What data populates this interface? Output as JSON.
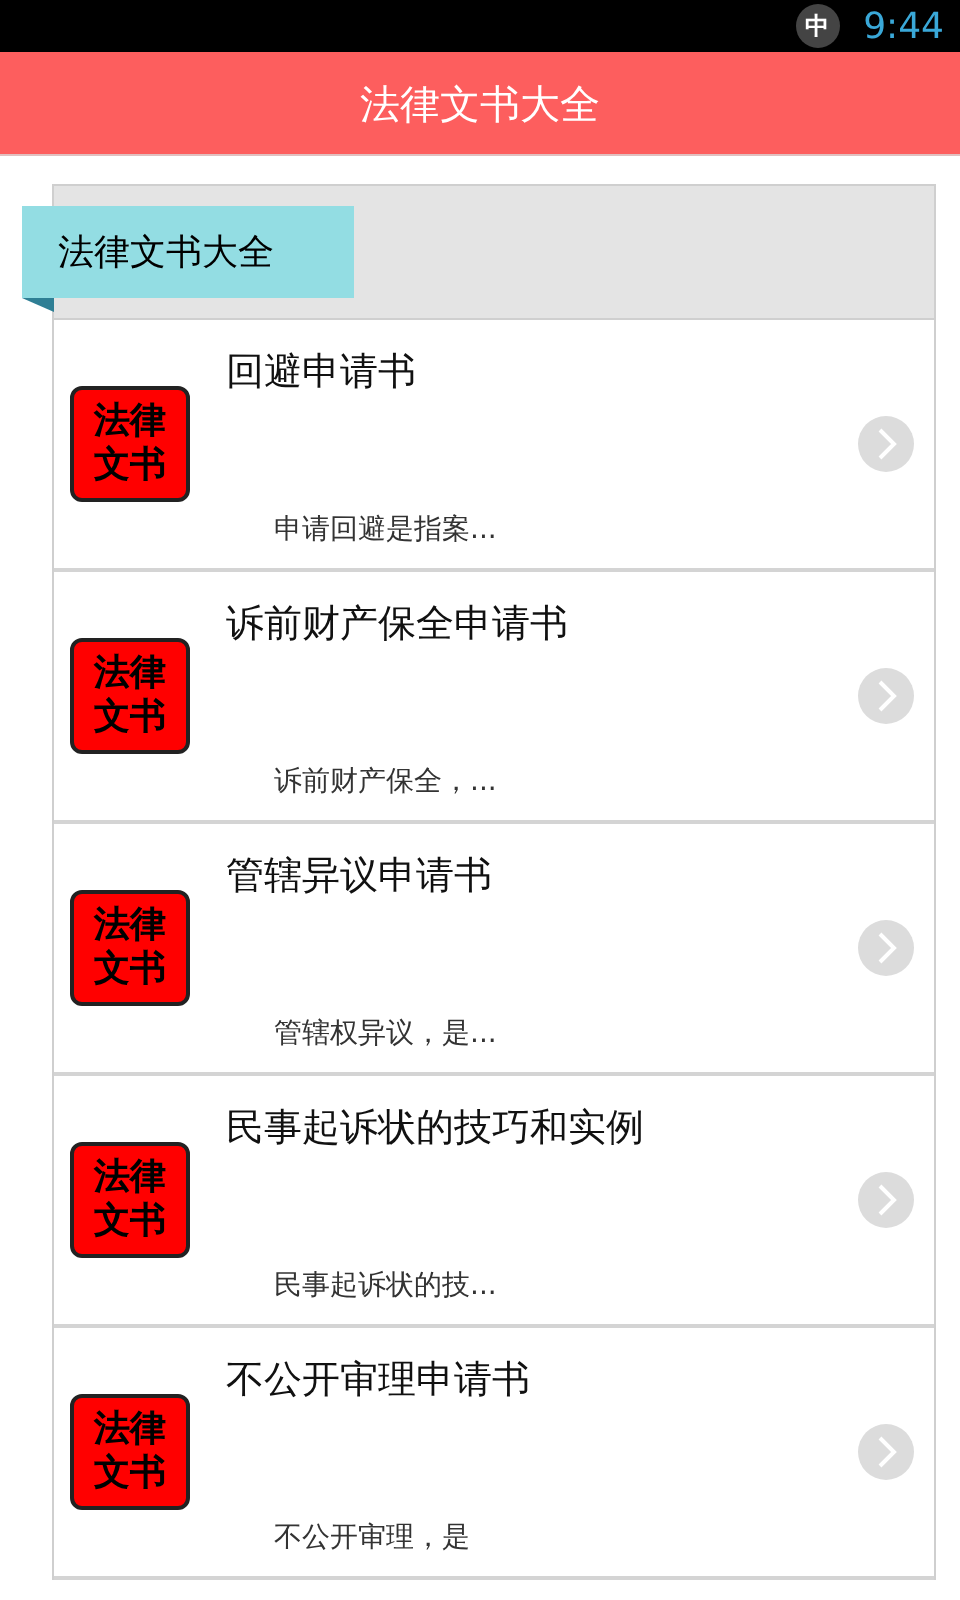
{
  "status_bar": {
    "ime": "中",
    "time": "9:44"
  },
  "app_bar": {
    "title": "法律文书大全"
  },
  "section": {
    "ribbon": "法律文书大全"
  },
  "items": [
    {
      "icon_text": "法律文书",
      "title": "回避申请书",
      "summary": "申请回避是指案..."
    },
    {
      "icon_text": "法律文书",
      "title": "诉前财产保全申请书",
      "summary": "诉前财产保全，..."
    },
    {
      "icon_text": "法律文书",
      "title": "管辖异议申请书",
      "summary": "管辖权异议，是..."
    },
    {
      "icon_text": "法律文书",
      "title": "民事起诉状的技巧和实例",
      "summary": "民事起诉状的技..."
    },
    {
      "icon_text": "法律文书",
      "title": "不公开审理申请书",
      "summary": "不公开审理，是"
    }
  ]
}
